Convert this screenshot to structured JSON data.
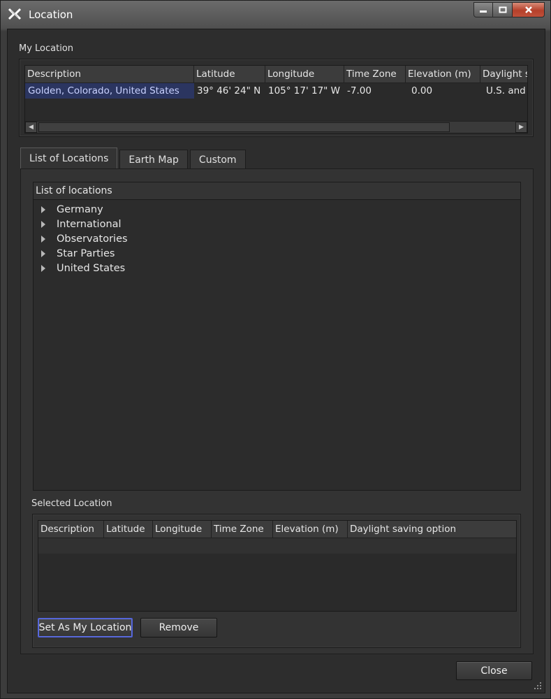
{
  "window": {
    "title": "Location",
    "icons": {
      "app": "x-app-icon",
      "minimize": "minimize-icon",
      "maximize": "maximize-icon",
      "close": "close-icon"
    }
  },
  "my_location": {
    "label": "My Location",
    "columns": [
      "Description",
      "Latitude",
      "Longitude",
      "Time Zone",
      "Elevation (m)",
      "Daylight s"
    ],
    "rows": [
      [
        "Golden, Colorado, United States",
        "39° 46' 24\" N",
        "105° 17' 17\" W",
        "-7.00",
        "0.00",
        "U.S. and"
      ]
    ]
  },
  "tabs": [
    {
      "label": "List of Locations",
      "active": true
    },
    {
      "label": "Earth Map",
      "active": false
    },
    {
      "label": "Custom",
      "active": false
    }
  ],
  "location_list": {
    "header": "List of locations",
    "items": [
      "Germany",
      "International",
      "Observatories",
      "Star Parties",
      "United States"
    ]
  },
  "selected_location": {
    "label": "Selected Location",
    "columns": [
      "Description",
      "Latitude",
      "Longitude",
      "Time Zone",
      "Elevation (m)",
      "Daylight saving option"
    ]
  },
  "buttons": {
    "set_as_my_location": "Set As My Location",
    "remove": "Remove",
    "close": "Close"
  },
  "colors": {
    "background": "#2d2d2d",
    "selection": "#2b3560",
    "focus_border": "#4d5ed6"
  }
}
